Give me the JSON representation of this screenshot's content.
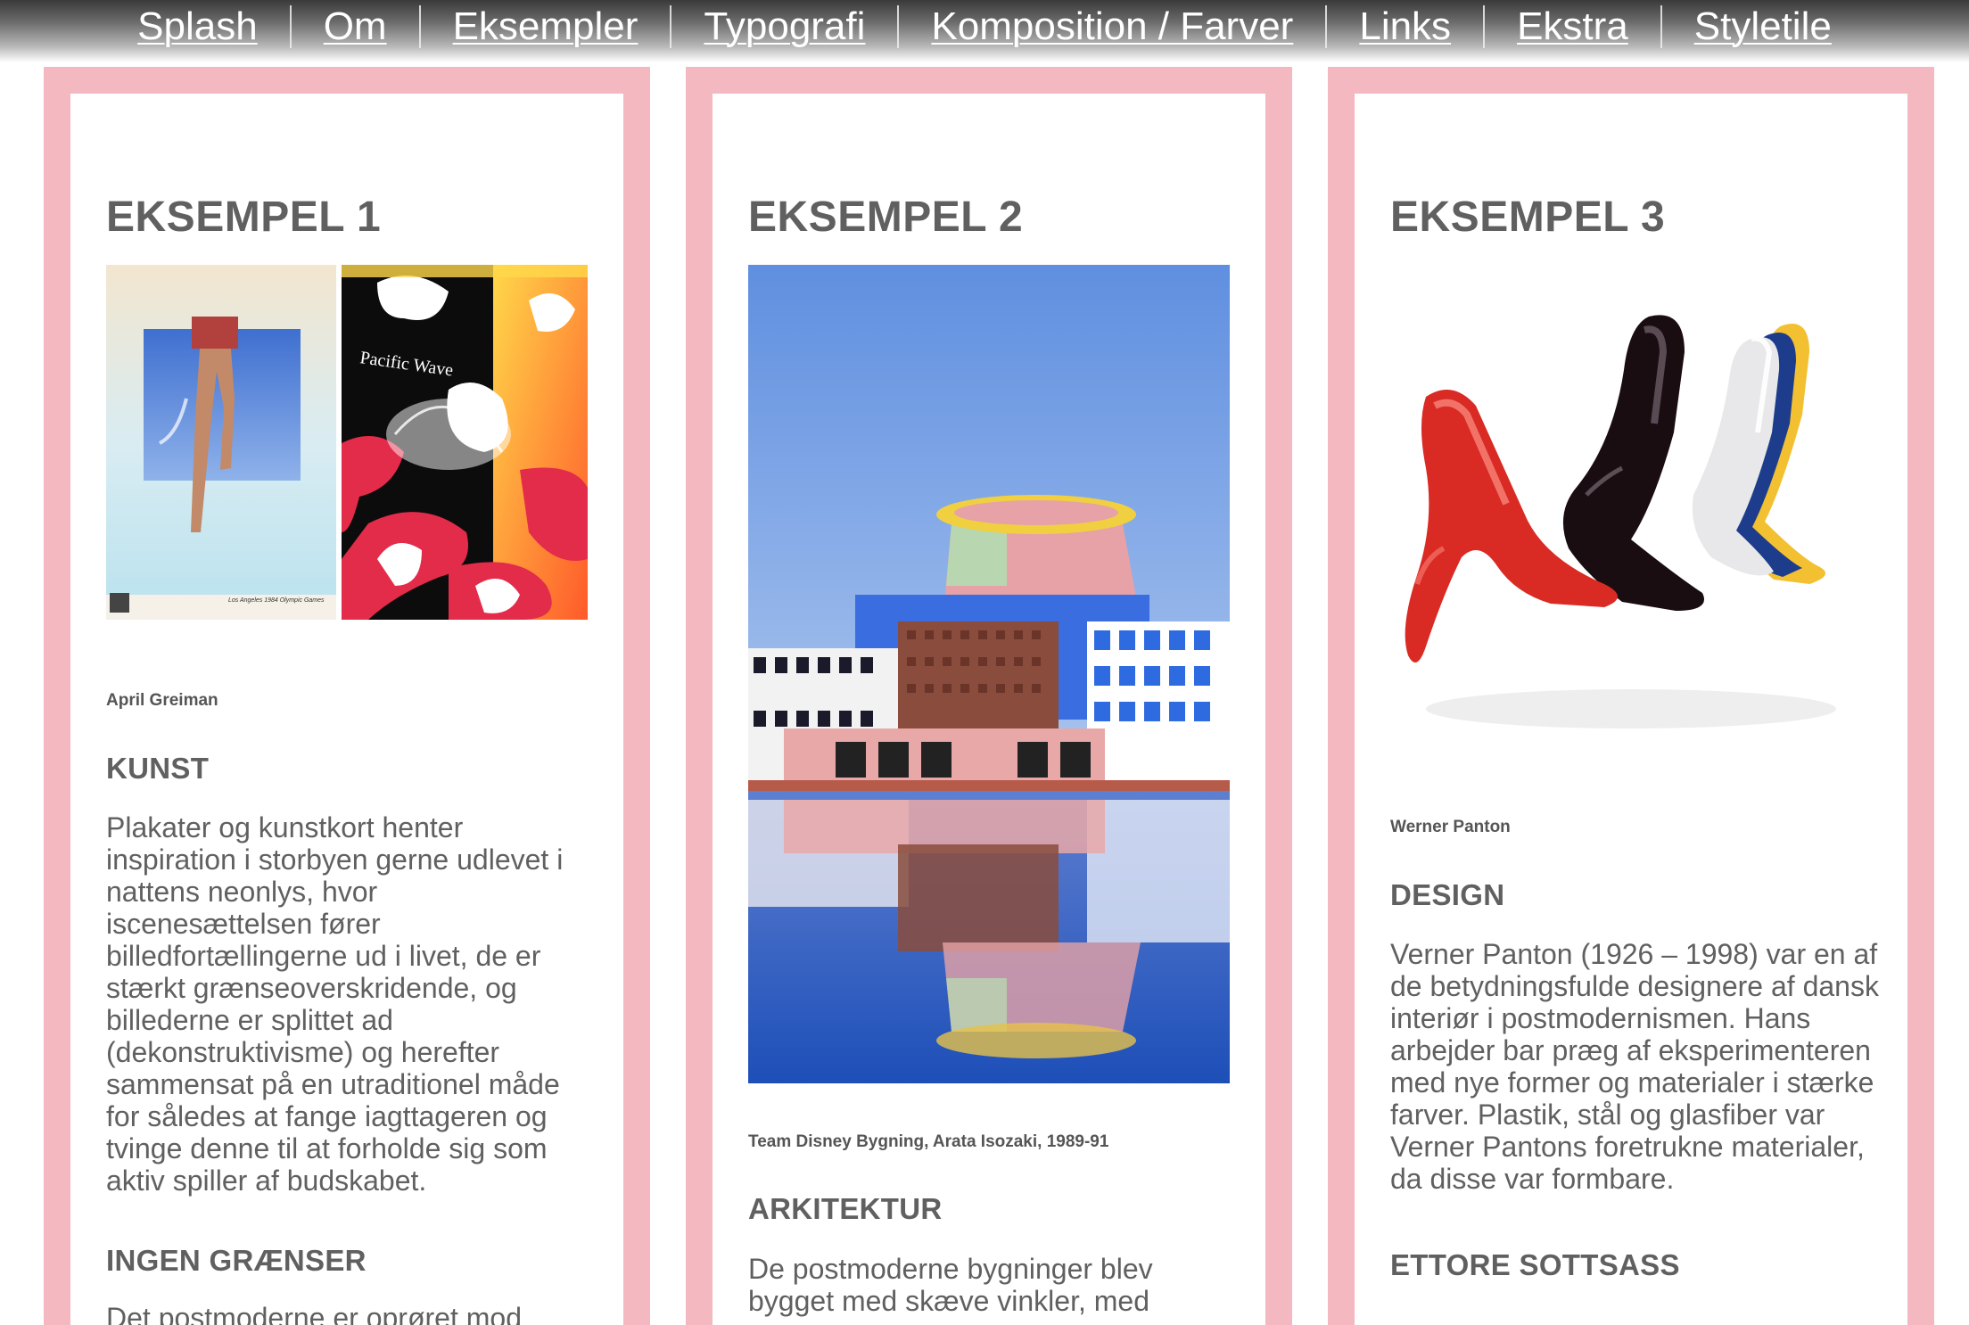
{
  "nav": {
    "items": [
      "Splash",
      "Om",
      "Eksempler",
      "Typografi",
      "Komposition / Farver",
      "Links",
      "Ekstra",
      "Styletile"
    ]
  },
  "colors": {
    "frame": "#f4b8c1",
    "text": "#606060"
  },
  "cards": [
    {
      "title": "EKSEMPEL 1",
      "caption": "April Greiman",
      "heading": "KUNST",
      "body": "Plakater og kunstkort henter inspiration i storbyen gerne udlevet i nattens neonlys, hvor iscenesættelsen fører billedfortællingerne ud i livet, de er stærkt grænseoverskridende, og billederne er splittet ad (dekonstruktivisme) og herefter sammensat på en utraditionel måde for således at fange iagttageren og tvinge denne til at forholde sig som aktiv spiller af budskabet.",
      "heading2": "INGEN GRÆNSER",
      "body2": "Det postmoderne er oprøret mod",
      "poster_left_text": "Los Angeles 1984 Olympic Games",
      "poster_right_text": "Pacific Wave"
    },
    {
      "title": "EKSEMPEL 2",
      "caption": "Team Disney Bygning, Arata Isozaki, 1989-91",
      "heading": "ARKITEKTUR",
      "body": "De postmoderne bygninger blev bygget med skæve vinkler, med"
    },
    {
      "title": "EKSEMPEL 3",
      "caption": "Werner Panton",
      "heading": "DESIGN",
      "body": "Verner Panton (1926 – 1998) var en af de betydningsfulde designere af dansk interiør i postmodernismen. Hans arbejder bar præg af eksperimenteren med nye former og materialer i stærke farver. Plastik, stål og glasfiber var Verner Pantons foretrukne materialer, da disse var formbare.",
      "heading2": "ETTORE SOTTSASS"
    }
  ]
}
